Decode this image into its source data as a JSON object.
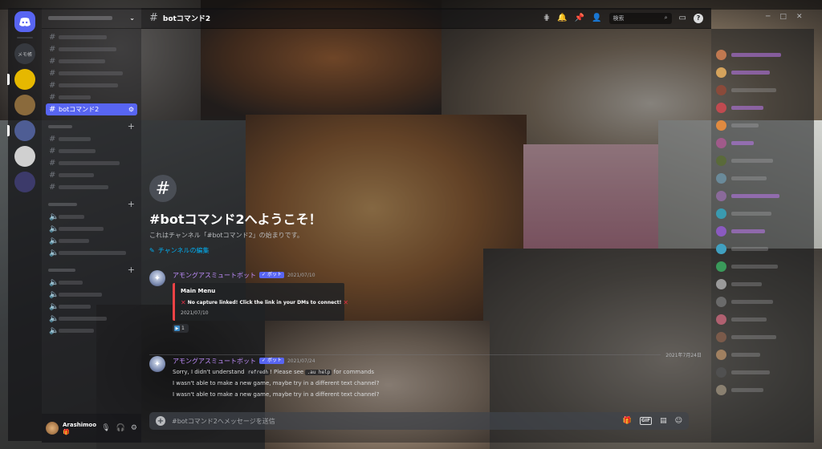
{
  "channel": {
    "name": "botコマンド2",
    "title": "botコマンド2"
  },
  "topbar": {
    "search_placeholder": "検索"
  },
  "welcome": {
    "title": "#botコマンド2へようこそ！",
    "subtitle": "これはチャンネル「#botコマンド2」の始まりです。",
    "edit_label": "チャンネルの編集"
  },
  "messages": [
    {
      "author": "アモングアスミュートボット",
      "bot_tag": "ボット",
      "timestamp": "2021/07/10",
      "embed": {
        "title": "Main Menu",
        "description": "No capture linked! Click the link in your DMs to connect!",
        "footer": "2021/07/10"
      },
      "reaction_count": "1"
    },
    {
      "author": "アモングアスミュートボット",
      "bot_tag": "ボット",
      "timestamp": "2021/07/24",
      "lines": [
        {
          "before": "Sorry, I didn't understand ",
          "code1": "refredh",
          "mid": "! Please see ",
          "code2": ".au help",
          "after": " for commands"
        },
        {
          "text": "I wasn't able to make a new game, maybe try in a different text channel?"
        },
        {
          "text": "I wasn't able to make a new game, maybe try in a different text channel?"
        }
      ]
    }
  ],
  "date_divider": "2021年7月24日",
  "composer": {
    "placeholder": "#botコマンド2へメッセージを送信",
    "gif_label": "GIF"
  },
  "sidebar": {
    "active_channel": "botコマンド2",
    "server_text": "メモ帳"
  },
  "user": {
    "name": "Arashimoo",
    "tag": "🎁"
  },
  "icons": {
    "accent": "#5865f2",
    "mention_color": "#c18eff",
    "link_color": "#00b0f4",
    "error_color": "#ed4245"
  }
}
